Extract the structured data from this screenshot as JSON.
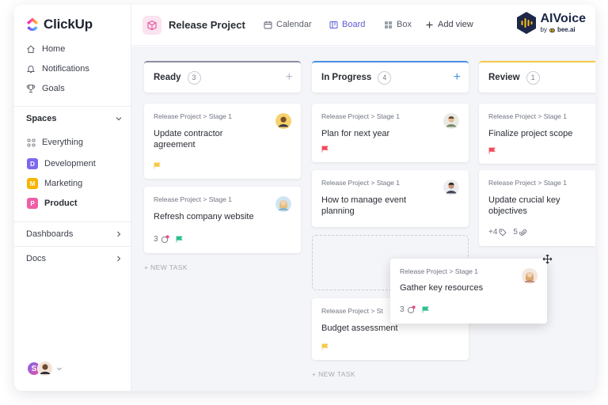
{
  "app": {
    "name": "ClickUp"
  },
  "sidebar": {
    "nav": [
      {
        "label": "Home",
        "icon": "home-icon"
      },
      {
        "label": "Notifications",
        "icon": "bell-icon"
      },
      {
        "label": "Goals",
        "icon": "trophy-icon"
      }
    ],
    "spaces_label": "Spaces",
    "everything_label": "Everything",
    "spaces": [
      {
        "badge": "D",
        "label": "Development",
        "color": "#7b68ee"
      },
      {
        "badge": "M",
        "label": "Marketing",
        "color": "#f7b500"
      },
      {
        "badge": "P",
        "label": "Product",
        "color": "#f05fa8"
      }
    ],
    "dashboards_label": "Dashboards",
    "docs_label": "Docs",
    "user_initial": "S"
  },
  "header": {
    "project_title": "Release Project",
    "views": [
      {
        "label": "Calendar",
        "icon": "calendar-icon"
      },
      {
        "label": "Board",
        "icon": "board-icon"
      },
      {
        "label": "Box",
        "icon": "box-icon"
      },
      {
        "label": "Add view",
        "icon": "plus-icon"
      }
    ],
    "brand": {
      "name": "AIVoice",
      "by": "by",
      "partner": "bee.ai"
    }
  },
  "board": {
    "columns": [
      {
        "name": "Ready",
        "count": "3",
        "accent": "#8c8fa3"
      },
      {
        "name": "In Progress",
        "count": "4",
        "accent": "#4a90e2"
      },
      {
        "name": "Review",
        "count": "1",
        "accent": "#f7c948"
      }
    ],
    "cards": {
      "ready_1": {
        "crumb": "Release Project > Stage 1",
        "title": "Update contractor agreement",
        "flag": "#f7c948"
      },
      "ready_2": {
        "crumb": "Release Project > Stage 1",
        "title": "Refresh company website",
        "subtasks": "3",
        "flag": "#2fbf8f"
      },
      "prog_1": {
        "crumb": "Release Project > Stage 1",
        "title": "Plan for next year",
        "flag": "#f04a5b"
      },
      "prog_2": {
        "crumb": "Release Project > Stage 1",
        "title": "How to manage event planning"
      },
      "prog_3": {
        "crumb": "Release Project > St",
        "title": "Budget assessment",
        "flag": "#f7c948"
      },
      "rev_1": {
        "crumb": "Release Project > Stage 1",
        "title": "Finalize project scope",
        "flag": "#f04a5b"
      },
      "rev_2": {
        "crumb": "Release Project > Stage 1",
        "title": "Update crucial key objectives",
        "tags": "+4",
        "attachments": "5"
      },
      "drag": {
        "crumb": "Release Project > Stage 1",
        "title": "Gather key resources",
        "subtasks": "3",
        "flag": "#2fbf8f"
      }
    },
    "new_task_label": "+ NEW TASK"
  }
}
